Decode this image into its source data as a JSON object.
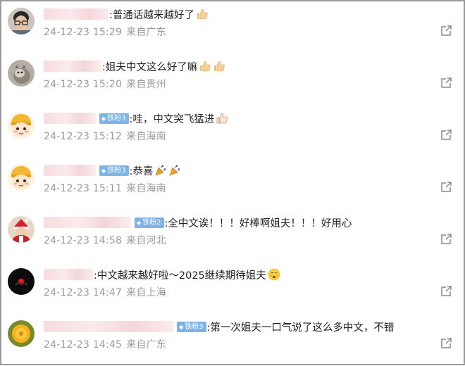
{
  "comments": [
    {
      "badge": "",
      "text": ":普通话越来越好了",
      "emojis": [
        "thumbs-up"
      ],
      "date": "24-12-23 15:29",
      "source": "来自广东",
      "avatar": "glasses-man"
    },
    {
      "badge": "",
      "text": ":姐夫中文这么好了嘛",
      "emojis": [
        "thumbs-up",
        "thumbs-up"
      ],
      "date": "24-12-23 15:20",
      "source": "来自贵州",
      "avatar": "cat"
    },
    {
      "badge": "铁粉3",
      "text": ":哇，中文突飞猛进",
      "emojis": [
        "thumbs-up-outline"
      ],
      "date": "24-12-23 15:12",
      "source": "来自海南",
      "avatar": "cartoon-kid"
    },
    {
      "badge": "铁粉3",
      "text": ":恭喜",
      "emojis": [
        "party-popper",
        "party-popper"
      ],
      "date": "24-12-23 15:11",
      "source": "来自海南",
      "avatar": "cartoon-kid"
    },
    {
      "badge": "铁粉2",
      "text": ":全中文诶！！！好棒啊姐夫！！！好用心",
      "emojis": [],
      "date": "24-12-23 14:58",
      "source": "来自河北",
      "avatar": "santa"
    },
    {
      "badge": "",
      "text": ":中文越来越好啦～2025继续期待姐夫",
      "emojis": [
        "shy-face"
      ],
      "date": "24-12-23 14:47",
      "source": "来自上海",
      "avatar": "dark-rose"
    },
    {
      "badge": "铁粉3",
      "text": ":第一次姐夫一口气说了这么多中文，不错",
      "emojis": [],
      "date": "24-12-23 14:45",
      "source": "来自广东",
      "avatar": "yellow-flower"
    }
  ],
  "icons": {
    "share": "share-icon",
    "badge_gem": "◆"
  },
  "colors": {
    "badge": "#7fb3e8",
    "meta_text": "#9a9a9a"
  }
}
